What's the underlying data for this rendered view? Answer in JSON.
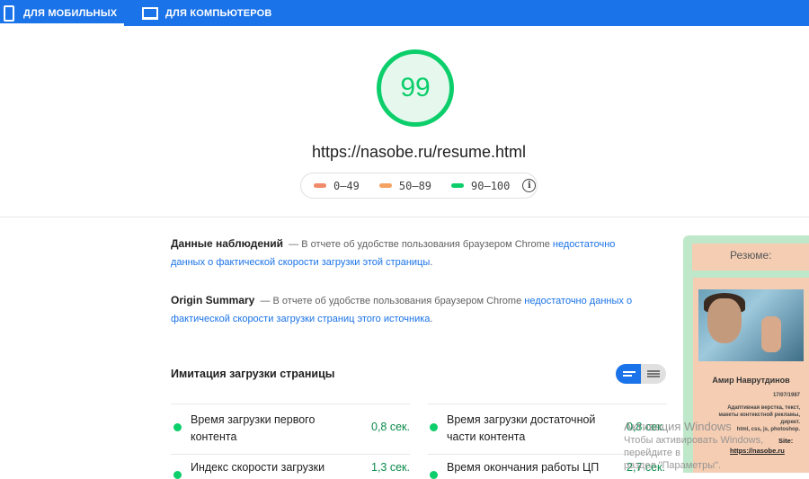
{
  "tabs": [
    {
      "label": "ДЛЯ МОБИЛЬНЫХ",
      "icon": "phone-icon",
      "active": true
    },
    {
      "label": "ДЛЯ КОМПЬЮТЕРОВ",
      "icon": "laptop-icon",
      "active": false
    }
  ],
  "score": {
    "value": "99",
    "color": "#0cce6b"
  },
  "url": "https://nasobe.ru/resume.html",
  "legend": [
    {
      "label": "0–49",
      "color": "#f08a6a"
    },
    {
      "label": "50–89",
      "color": "#f5a261"
    },
    {
      "label": "90–100",
      "color": "#0cce6b"
    }
  ],
  "field_data": {
    "title": "Данные наблюдений",
    "text": "— В отчете об удобстве пользования браузером Chrome ",
    "link": "недостаточно данных о фактической скорости загрузки этой страницы",
    "tail": "."
  },
  "origin_summary": {
    "title": "Origin Summary",
    "text": "— В отчете об удобстве пользования браузером Chrome ",
    "link": "недостаточно данных о фактической скорости загрузки страниц этого источника",
    "tail": "."
  },
  "lab": {
    "title": "Имитация загрузки страницы",
    "metrics": [
      {
        "label_line1": "Время загрузки первого",
        "label_line2": "контента",
        "value": "0,8 сек."
      },
      {
        "label_line1": "Время загрузки достаточной",
        "label_line2": "части контента",
        "value": "0,8 сек."
      },
      {
        "label_line1": "Индекс скорости загрузки",
        "label_line2": "",
        "value": "1,3 сек."
      },
      {
        "label_line1": "Время окончания работы ЦП",
        "label_line2": "",
        "value": "2,7 сек."
      }
    ]
  },
  "preview": {
    "header": "Резюме:",
    "name": "Амир Наврутдинов",
    "date": "17/07/1987",
    "desc1": "Адаптивная верстка, текст,",
    "desc2": "макеты контекстной рекламы,",
    "desc3": "директ.",
    "desc4": "html, css, js, photoshop.",
    "site_label": "Site:",
    "site": "https://nasobe.ru"
  },
  "watermark": {
    "line1": "Активация Windows",
    "line2": "Чтобы активировать Windows, перейдите в",
    "line3": "раздел \"Параметры\"."
  }
}
